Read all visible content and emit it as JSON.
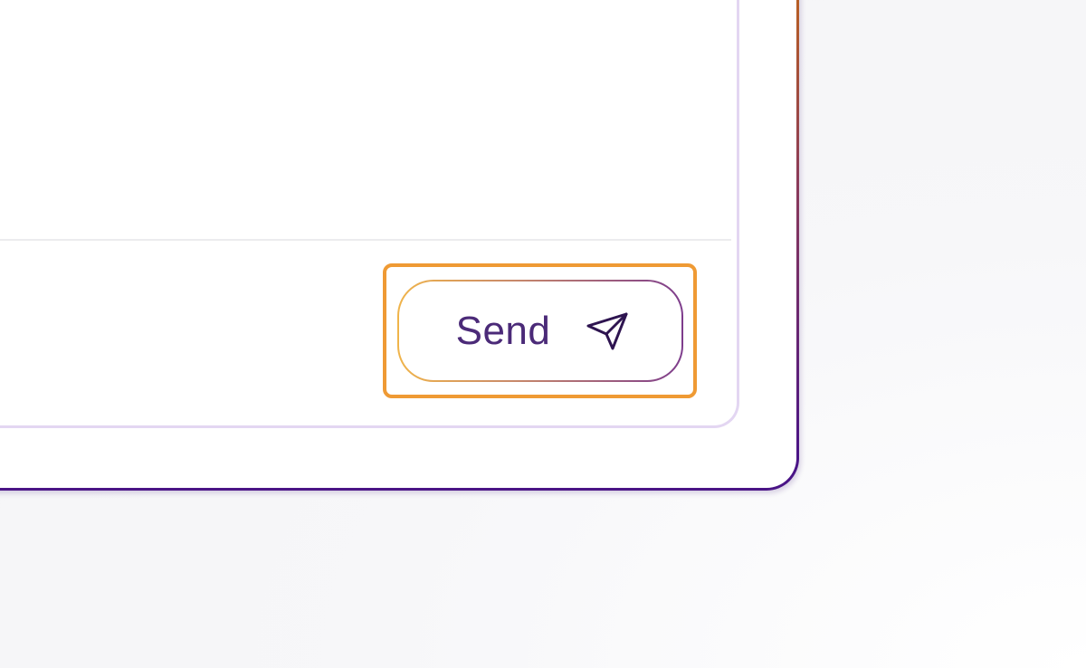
{
  "composer": {
    "send_button": {
      "label": "Send",
      "icon": "send-icon"
    }
  },
  "colors": {
    "accent_purple": "#4a1486",
    "focus_orange": "#ef9a34",
    "label_purple": "#4b2a78"
  }
}
